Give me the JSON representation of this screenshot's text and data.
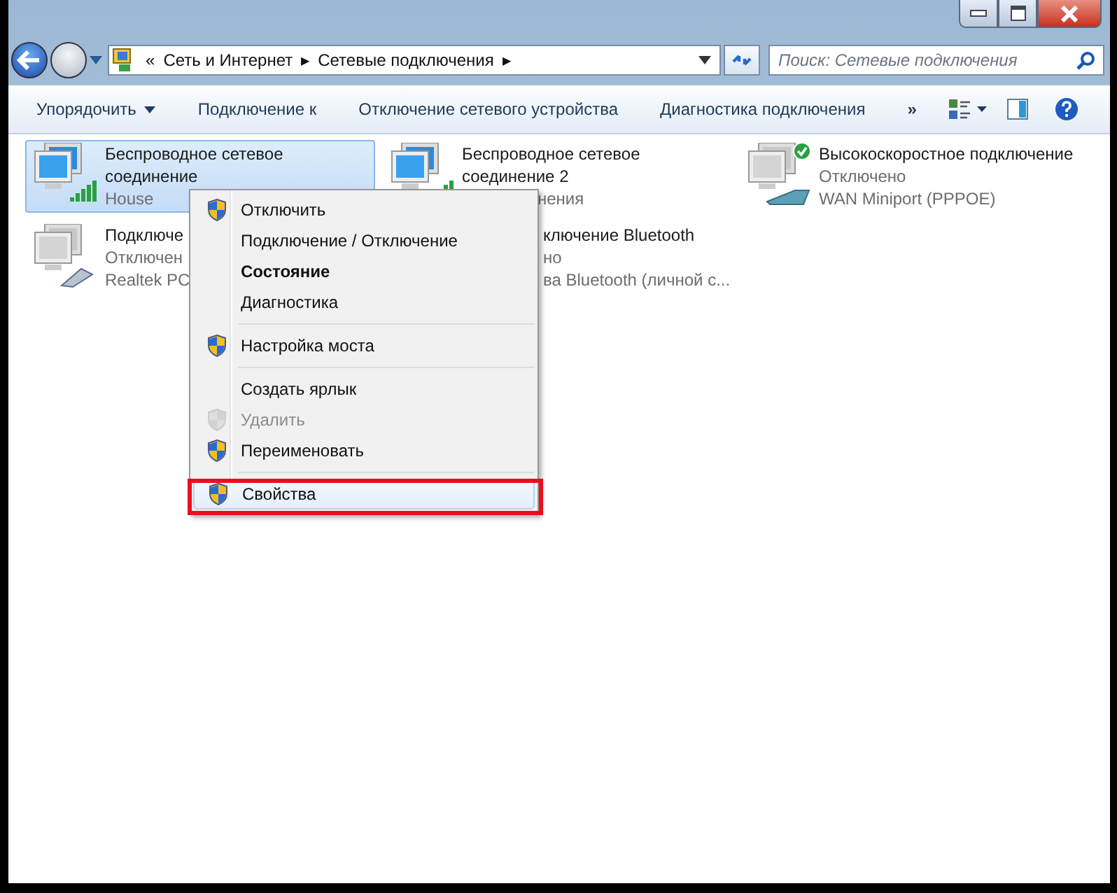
{
  "address": {
    "overflow": "«",
    "crumbs": [
      {
        "label": "Сеть и Интернет",
        "arrow": "▶"
      },
      {
        "label": "Сетевые подключения",
        "arrow": "▶"
      }
    ]
  },
  "search": {
    "placeholder": "Поиск: Сетевые подключения"
  },
  "toolbar": {
    "items": [
      {
        "label": "Упорядочить",
        "dropdown": true
      },
      {
        "label": "Подключение к",
        "dropdown": false
      },
      {
        "label": "Отключение сетевого устройства",
        "dropdown": false
      },
      {
        "label": "Диагностика подключения",
        "dropdown": false
      }
    ],
    "more": "»"
  },
  "connections": [
    {
      "kind": "wireless",
      "name": "Беспроводное сетевое соединение",
      "status": "House",
      "selected": true
    },
    {
      "kind": "wireless",
      "name": "Беспроводное сетевое соединение 2",
      "status": "нения",
      "selected": false
    },
    {
      "kind": "modem",
      "name": "Высокоскоростное подключение",
      "status": "Отключено",
      "device": "WAN Miniport (PPPOE)",
      "selected": false
    },
    {
      "kind": "ethernet",
      "name": "Подключе",
      "status": "Отключен",
      "device": "Realtek PC",
      "selected": false
    },
    {
      "kind": "covered",
      "name": "ключение Bluetooth",
      "status": "но",
      "device": "ва Bluetooth (личной с...",
      "selected": false
    }
  ],
  "context_menu": [
    {
      "label": "Отключить",
      "shield": true,
      "bold": false,
      "disabled": false,
      "separator_after": false,
      "highlighted": false
    },
    {
      "label": "Подключение / Отключение",
      "shield": false,
      "bold": false,
      "disabled": false,
      "separator_after": false,
      "highlighted": false
    },
    {
      "label": "Состояние",
      "shield": false,
      "bold": true,
      "disabled": false,
      "separator_after": false,
      "highlighted": false
    },
    {
      "label": "Диагностика",
      "shield": false,
      "bold": false,
      "disabled": false,
      "separator_after": true,
      "highlighted": false
    },
    {
      "label": "Настройка моста",
      "shield": true,
      "bold": false,
      "disabled": false,
      "separator_after": true,
      "highlighted": false
    },
    {
      "label": "Создать ярлык",
      "shield": false,
      "bold": false,
      "disabled": false,
      "separator_after": false,
      "highlighted": false
    },
    {
      "label": "Удалить",
      "shield": true,
      "bold": false,
      "disabled": true,
      "separator_after": false,
      "highlighted": false
    },
    {
      "label": "Переименовать",
      "shield": true,
      "bold": false,
      "disabled": false,
      "separator_after": true,
      "highlighted": false
    },
    {
      "label": "Свойства",
      "shield": true,
      "bold": false,
      "disabled": false,
      "separator_after": false,
      "highlighted": true
    }
  ]
}
